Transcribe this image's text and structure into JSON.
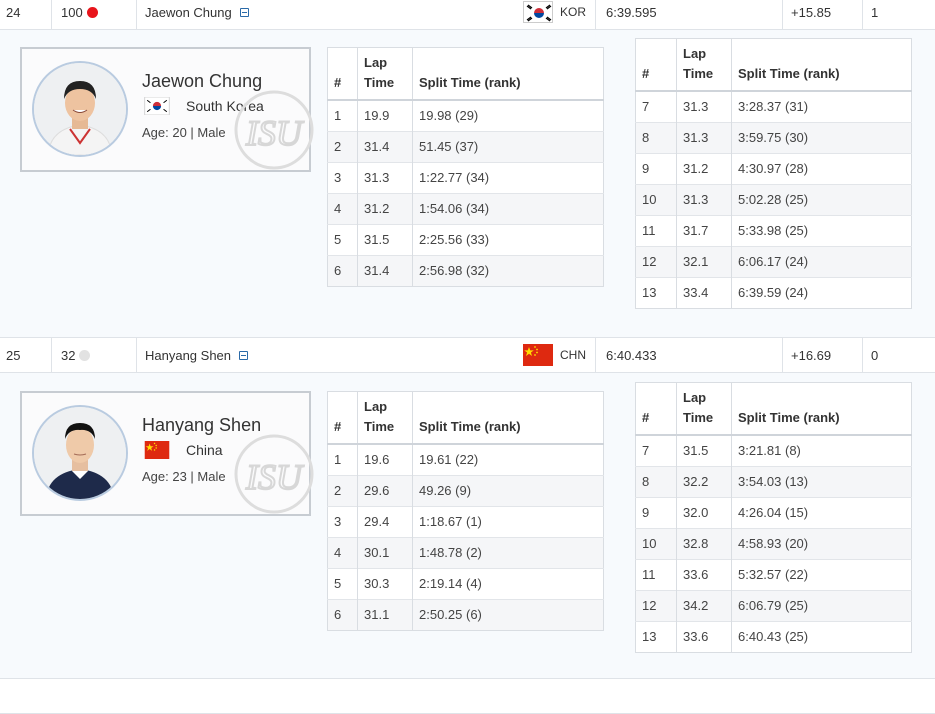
{
  "athletes": [
    {
      "rank": "24",
      "bib": "100",
      "bib_dot_color": "#e8141b",
      "name": "Jaewon Chung",
      "country_code": "KOR",
      "time": "6:39.595",
      "diff": "+15.85",
      "points": "1",
      "profile": {
        "name": "Jaewon Chung",
        "country": "South Korea",
        "age_gender": "Age: 20 | Male"
      },
      "laps_a": [
        [
          "1",
          "19.9",
          "19.98 (29)"
        ],
        [
          "2",
          "31.4",
          "51.45 (37)"
        ],
        [
          "3",
          "31.3",
          "1:22.77 (34)"
        ],
        [
          "4",
          "31.2",
          "1:54.06 (34)"
        ],
        [
          "5",
          "31.5",
          "2:25.56 (33)"
        ],
        [
          "6",
          "31.4",
          "2:56.98 (32)"
        ]
      ],
      "laps_b": [
        [
          "7",
          "31.3",
          "3:28.37 (31)"
        ],
        [
          "8",
          "31.3",
          "3:59.75 (30)"
        ],
        [
          "9",
          "31.2",
          "4:30.97 (28)"
        ],
        [
          "10",
          "31.3",
          "5:02.28 (25)"
        ],
        [
          "11",
          "31.7",
          "5:33.98 (25)"
        ],
        [
          "12",
          "32.1",
          "6:06.17 (24)"
        ],
        [
          "13",
          "33.4",
          "6:39.59 (24)"
        ]
      ]
    },
    {
      "rank": "25",
      "bib": "32",
      "bib_dot_color": "#e2e2e2",
      "name": "Hanyang Shen",
      "country_code": "CHN",
      "time": "6:40.433",
      "diff": "+16.69",
      "points": "0",
      "profile": {
        "name": "Hanyang Shen",
        "country": "China",
        "age_gender": "Age: 23 | Male"
      },
      "laps_a": [
        [
          "1",
          "19.6",
          "19.61 (22)"
        ],
        [
          "2",
          "29.6",
          "49.26 (9)"
        ],
        [
          "3",
          "29.4",
          "1:18.67 (1)"
        ],
        [
          "4",
          "30.1",
          "1:48.78 (2)"
        ],
        [
          "5",
          "30.3",
          "2:19.14 (4)"
        ],
        [
          "6",
          "31.1",
          "2:50.25 (6)"
        ]
      ],
      "laps_b": [
        [
          "7",
          "31.5",
          "3:21.81 (8)"
        ],
        [
          "8",
          "32.2",
          "3:54.03 (13)"
        ],
        [
          "9",
          "32.0",
          "4:26.04 (15)"
        ],
        [
          "10",
          "32.8",
          "4:58.93 (20)"
        ],
        [
          "11",
          "33.6",
          "5:32.57 (22)"
        ],
        [
          "12",
          "34.2",
          "6:06.79 (25)"
        ],
        [
          "13",
          "33.6",
          "6:40.43 (25)"
        ]
      ]
    }
  ],
  "table_headers": {
    "num": "#",
    "lap_line1": "Lap",
    "lap_line2": "Time",
    "split": "Split Time (rank)"
  },
  "logo_text": "ISU",
  "colors": {
    "link_blue": "#2a6aa8",
    "row_border": "#dfe3e8",
    "kor_red": "#cd2e3a",
    "kor_blue": "#0047a0",
    "chn_red": "#de2910",
    "chn_yellow": "#ffde00"
  }
}
